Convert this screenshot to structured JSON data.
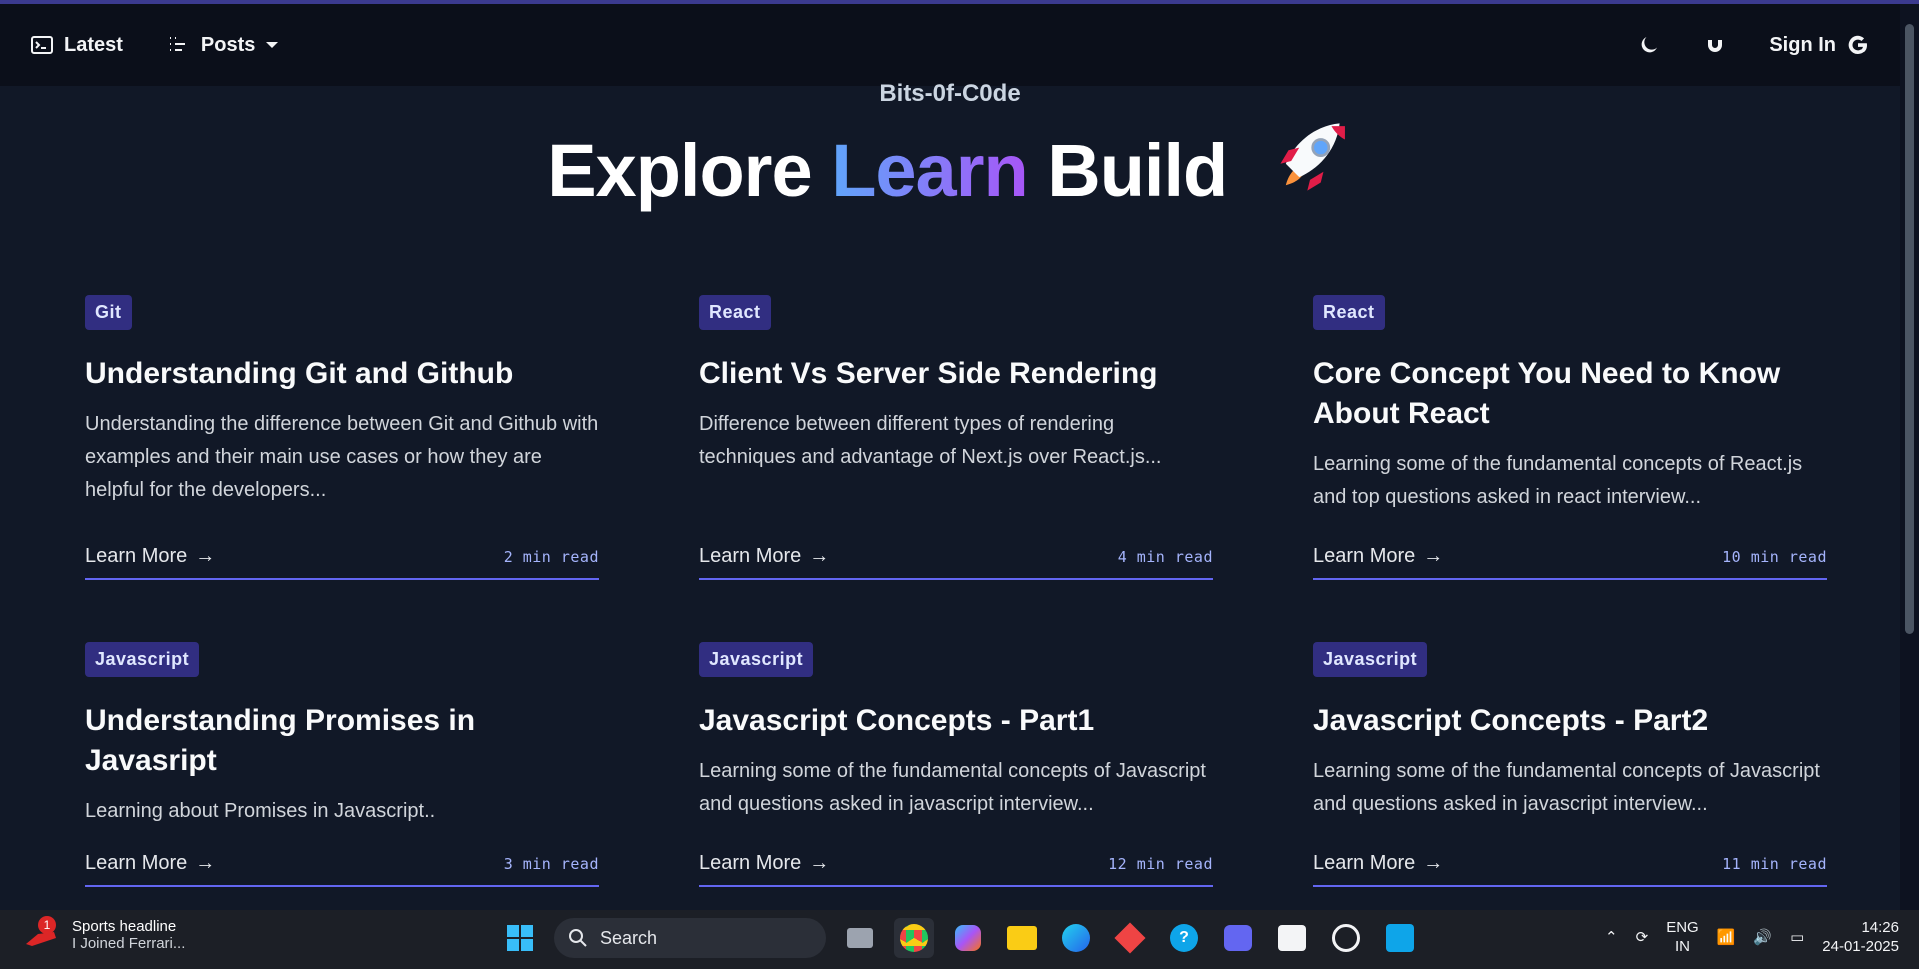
{
  "nav": {
    "latest_label": "Latest",
    "posts_label": "Posts",
    "signin_label": "Sign In"
  },
  "hero": {
    "site_name": "Bits-0f-C0de",
    "word1": "Explore",
    "word2": "Learn",
    "word3": "Build"
  },
  "posts": [
    {
      "tag": "Git",
      "title": "Understanding Git and Github",
      "desc": "Understanding the difference between Git and Github with examples and their main use cases or how they are helpful for the developers...",
      "link": "Learn More",
      "read": "2 min read"
    },
    {
      "tag": "React",
      "title": "Client Vs Server Side Rendering",
      "desc": "Difference between different types of rendering techniques and advantage of Next.js over React.js...",
      "link": "Learn More",
      "read": "4 min read"
    },
    {
      "tag": "React",
      "title": "Core Concept You Need to Know About React",
      "desc": "Learning some of the fundamental concepts of React.js and top questions asked in react interview...",
      "link": "Learn More",
      "read": "10 min read"
    },
    {
      "tag": "Javascript",
      "title": "Understanding Promises in Javasript",
      "desc": "Learning about Promises in Javascript..",
      "link": "Learn More",
      "read": "3 min read"
    },
    {
      "tag": "Javascript",
      "title": "Javascript Concepts - Part1",
      "desc": "Learning some of the fundamental concepts of Javascript and questions asked in javascript interview...",
      "link": "Learn More",
      "read": "12 min read"
    },
    {
      "tag": "Javascript",
      "title": "Javascript Concepts - Part2",
      "desc": "Learning some of the fundamental concepts of Javascript and questions asked in javascript interview...",
      "link": "Learn More",
      "read": "11 min read"
    }
  ],
  "taskbar": {
    "news_title": "Sports headline",
    "news_sub": "I Joined Ferrari...",
    "news_badge": "1",
    "search_placeholder": "Search",
    "lang_top": "ENG",
    "lang_bottom": "IN",
    "time": "14:26",
    "date": "24-01-2025"
  },
  "colors": {
    "background": "#111827",
    "accent": "#6366f1",
    "tag_bg": "#312e81"
  }
}
